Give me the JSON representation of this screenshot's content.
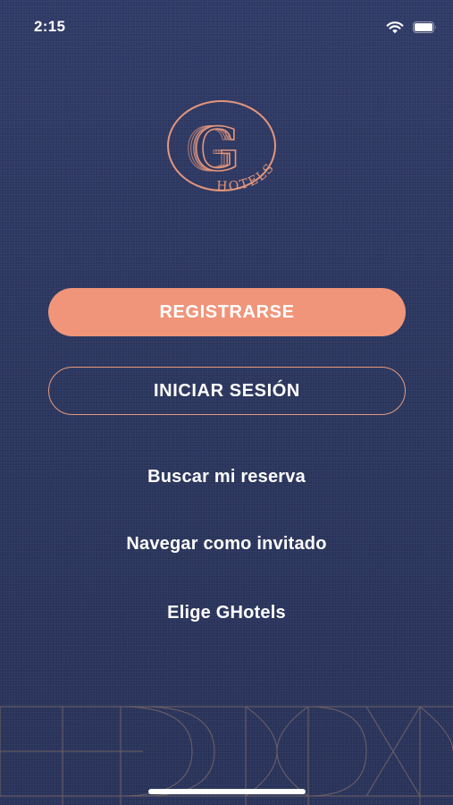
{
  "status_bar": {
    "time": "2:15",
    "wifi_icon": "wifi-icon",
    "battery_icon": "battery-icon"
  },
  "logo": {
    "letter": "G",
    "wordmark": "HOTELS",
    "icon": "ghotels-logo",
    "color": "#e3967c"
  },
  "actions": {
    "register_label": "REGISTRARSE",
    "login_label": "INICIAR SESIÓN",
    "find_booking_label": "Buscar mi reserva",
    "guest_label": "Navegar como invitado",
    "choose_label": "Elige GHotels"
  },
  "colors": {
    "background": "#2c3760",
    "accent": "#f0957a",
    "text": "#ffffff"
  }
}
